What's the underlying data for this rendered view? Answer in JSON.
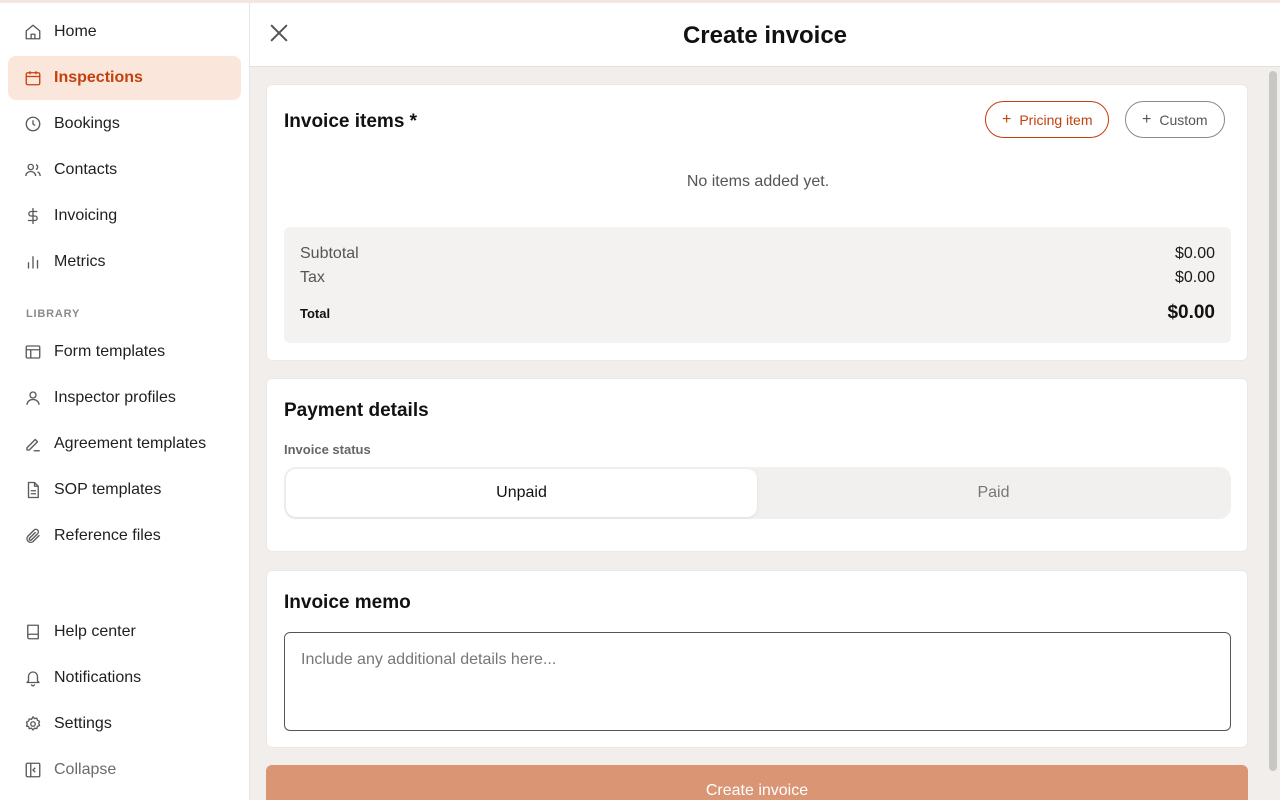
{
  "sidebar": {
    "primary": [
      {
        "label": "Home",
        "icon": "home-icon"
      },
      {
        "label": "Inspections",
        "icon": "calendar-icon",
        "active": true
      },
      {
        "label": "Bookings",
        "icon": "clock-icon"
      },
      {
        "label": "Contacts",
        "icon": "users-icon"
      },
      {
        "label": "Invoicing",
        "icon": "dollar-icon"
      },
      {
        "label": "Metrics",
        "icon": "bar-chart-icon"
      }
    ],
    "library_label": "LIBRARY",
    "library": [
      {
        "label": "Form templates",
        "icon": "layout-icon"
      },
      {
        "label": "Inspector profiles",
        "icon": "user-icon"
      },
      {
        "label": "Agreement templates",
        "icon": "signature-icon"
      },
      {
        "label": "SOP templates",
        "icon": "document-icon"
      },
      {
        "label": "Reference files",
        "icon": "paperclip-icon"
      }
    ],
    "footer": [
      {
        "label": "Help center",
        "icon": "book-icon"
      },
      {
        "label": "Notifications",
        "icon": "bell-icon"
      },
      {
        "label": "Settings",
        "icon": "gear-icon"
      },
      {
        "label": "Collapse",
        "icon": "collapse-icon"
      }
    ]
  },
  "header": {
    "title": "Create invoice"
  },
  "items_card": {
    "title": "Invoice items *",
    "pricing_button": "Pricing item",
    "custom_button": "Custom",
    "empty_text": "No items added yet.",
    "subtotal_label": "Subtotal",
    "subtotal_value": "$0.00",
    "tax_label": "Tax",
    "tax_value": "$0.00",
    "total_label": "Total",
    "total_value": "$0.00"
  },
  "payment_card": {
    "title": "Payment details",
    "status_label": "Invoice status",
    "options": [
      "Unpaid",
      "Paid"
    ],
    "selected": "Unpaid"
  },
  "memo_card": {
    "title": "Invoice memo",
    "placeholder": "Include any additional details here..."
  },
  "create_button": "Create invoice",
  "colors": {
    "accent": "#c2410c",
    "active_bg": "#fbe6dc",
    "button_bg": "#d99574"
  }
}
